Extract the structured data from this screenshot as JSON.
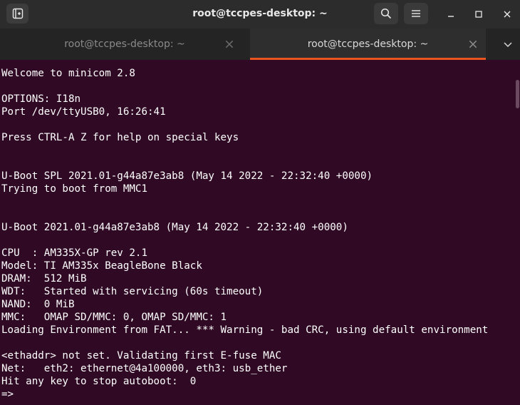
{
  "window": {
    "title": "root@tccpes-desktop: ~"
  },
  "tabs": [
    {
      "label": "root@tccpes-desktop: ~",
      "active": false
    },
    {
      "label": "root@tccpes-desktop: ~",
      "active": true
    }
  ],
  "icons": {
    "new_tab": "new-tab-icon",
    "search": "search-icon",
    "menu": "hamburger-menu-icon",
    "minimize": "minimize-icon",
    "maximize": "maximize-icon",
    "close": "close-icon",
    "tab_close": "close-icon",
    "tab_overflow": "chevron-down-icon"
  },
  "colors": {
    "terminal_bg": "#300a24",
    "terminal_fg": "#ffffff",
    "accent": "#e95420",
    "titlebar_bg": "#2c2c2c"
  },
  "terminal": {
    "lines": [
      "Welcome to minicom 2.8",
      "",
      "OPTIONS: I18n",
      "Port /dev/ttyUSB0, 16:26:41",
      "",
      "Press CTRL-A Z for help on special keys",
      "",
      "",
      "U-Boot SPL 2021.01-g44a87e3ab8 (May 14 2022 - 22:32:40 +0000)",
      "Trying to boot from MMC1",
      "",
      "",
      "U-Boot 2021.01-g44a87e3ab8 (May 14 2022 - 22:32:40 +0000)",
      "",
      "CPU  : AM335X-GP rev 2.1",
      "Model: TI AM335x BeagleBone Black",
      "DRAM:  512 MiB",
      "WDT:   Started with servicing (60s timeout)",
      "NAND:  0 MiB",
      "MMC:   OMAP SD/MMC: 0, OMAP SD/MMC: 1",
      "Loading Environment from FAT... *** Warning - bad CRC, using default environment",
      "",
      "<ethaddr> not set. Validating first E-fuse MAC",
      "Net:   eth2: ethernet@4a100000, eth3: usb_ether",
      "Hit any key to stop autoboot:  0",
      "=>"
    ]
  }
}
